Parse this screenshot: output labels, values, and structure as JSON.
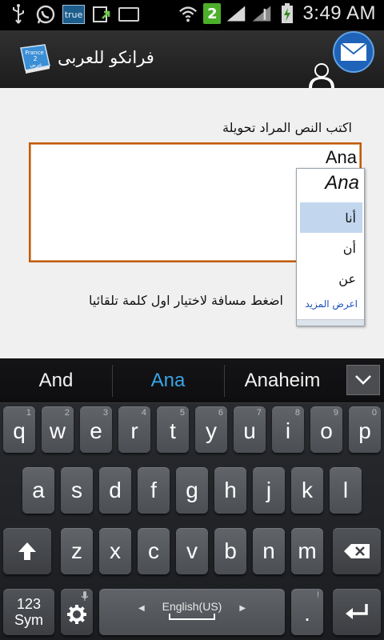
{
  "status_bar": {
    "carrier_badge": "true",
    "notification_count": "2",
    "time": "3:49 AM"
  },
  "action_bar": {
    "app_title": "فرانكو للعربى",
    "app_logo_label": "Franco 2 عربي"
  },
  "main": {
    "prompt": "اكتب النص المراد تحويلة",
    "input_value": "Ana",
    "hint": "اضغط مسافة لاختيار اول كلمة تلقائيا"
  },
  "suggestions": {
    "source_word": "Ana",
    "items": [
      "أنا",
      "أن",
      "عن"
    ],
    "selected_index": 0,
    "more_label": "اعرض المزيد"
  },
  "keyboard": {
    "candidates": [
      "And",
      "Ana",
      "Anaheim"
    ],
    "active_candidate": "Ana",
    "row1": [
      {
        "k": "q",
        "a": "1"
      },
      {
        "k": "w",
        "a": "2"
      },
      {
        "k": "e",
        "a": "3"
      },
      {
        "k": "r",
        "a": "4"
      },
      {
        "k": "t",
        "a": "5"
      },
      {
        "k": "y",
        "a": "6"
      },
      {
        "k": "u",
        "a": "7"
      },
      {
        "k": "i",
        "a": "8"
      },
      {
        "k": "o",
        "a": "9"
      },
      {
        "k": "p",
        "a": "0"
      }
    ],
    "row2": [
      "a",
      "s",
      "d",
      "f",
      "g",
      "h",
      "j",
      "k",
      "l"
    ],
    "row3": [
      "z",
      "x",
      "c",
      "v",
      "b",
      "n",
      "m"
    ],
    "sym_label_top": "123",
    "sym_label_bottom": "Sym",
    "space_label": "English(US)",
    "period_label": ".",
    "period_alt": "!"
  },
  "colors": {
    "input_border": "#c25b00",
    "active_candidate": "#3aa5e6",
    "suggestion_highlight": "#c2d6ee",
    "more_link": "#1a4eb8"
  }
}
